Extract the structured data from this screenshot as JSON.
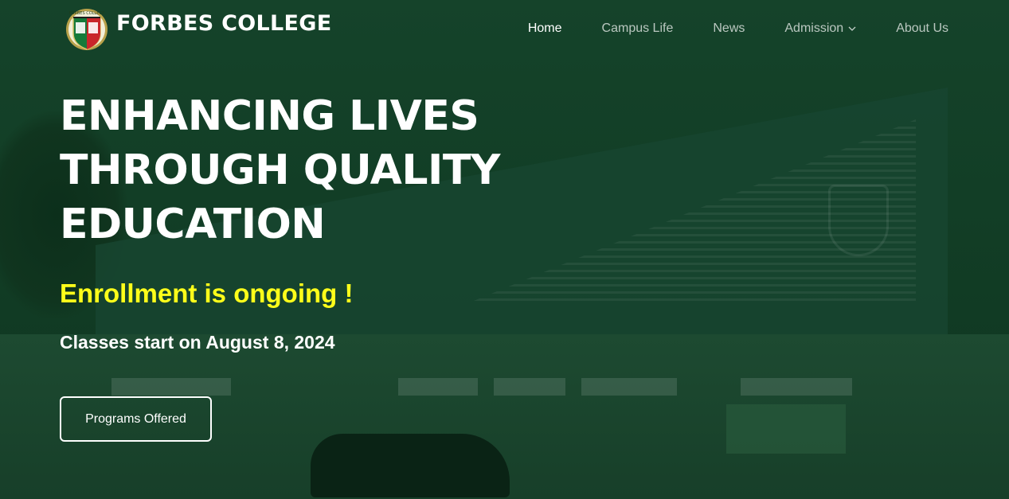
{
  "header": {
    "brand": "FORBES COLLEGE",
    "logo_text": "FORBES COLLEGE",
    "nav": [
      {
        "label": "Home",
        "active": true
      },
      {
        "label": "Campus Life"
      },
      {
        "label": "News"
      },
      {
        "label": "Admission",
        "has_dropdown": true
      },
      {
        "label": "About Us"
      }
    ]
  },
  "hero": {
    "headline": [
      "ENHANCING LIVES",
      "THROUGH QUALITY",
      "EDUCATION"
    ],
    "enrollment": "Enrollment is ongoing !",
    "classes": "Classes start on August 8, 2024",
    "cta_label": "Programs Offered"
  },
  "colors": {
    "overlay": "#123e26",
    "accent_yellow": "#ffff1a",
    "text": "#ffffff"
  },
  "icons": [
    "school-crest-logo",
    "chevron-down-icon"
  ]
}
